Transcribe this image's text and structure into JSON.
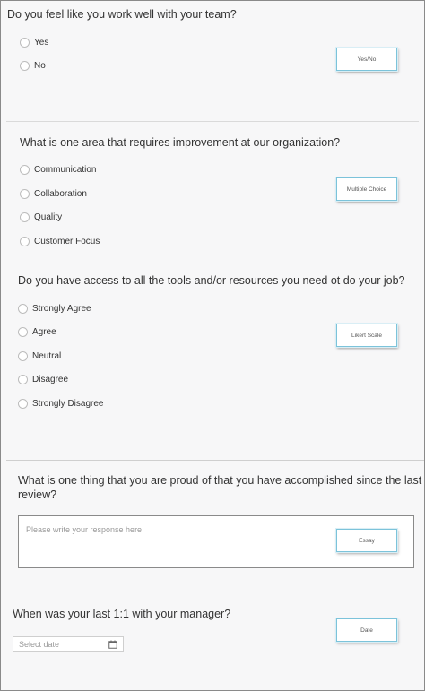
{
  "q1": {
    "question": "Do you feel like you work well with your team?",
    "options": [
      "Yes",
      "No"
    ],
    "tag": "Yes/No"
  },
  "q2": {
    "question": "What is one area that requires improvement at our organization?",
    "options": [
      "Communication",
      "Collaboration",
      "Quality",
      "Customer Focus"
    ],
    "tag": "Multiple Choice"
  },
  "q3": {
    "question": "Do you have access to all the tools and/or resources you need ot do your job?",
    "options": [
      "Strongly Agree",
      "Agree",
      "Neutral",
      "Disagree",
      "Strongly Disagree"
    ],
    "tag": "Likert Scale"
  },
  "q4": {
    "question_line1": "What is one thing that you are proud of that you have accomplished since the last",
    "question_line2": "review?",
    "placeholder": "Please write your response here",
    "tag": "Essay"
  },
  "q5": {
    "question": "When was your last 1:1 with your manager?",
    "placeholder": "Select date",
    "icon": "calendar-icon",
    "tag": "Date"
  },
  "colors": {
    "tag_border": "#7cc3da",
    "background": "#f7f7f8"
  }
}
